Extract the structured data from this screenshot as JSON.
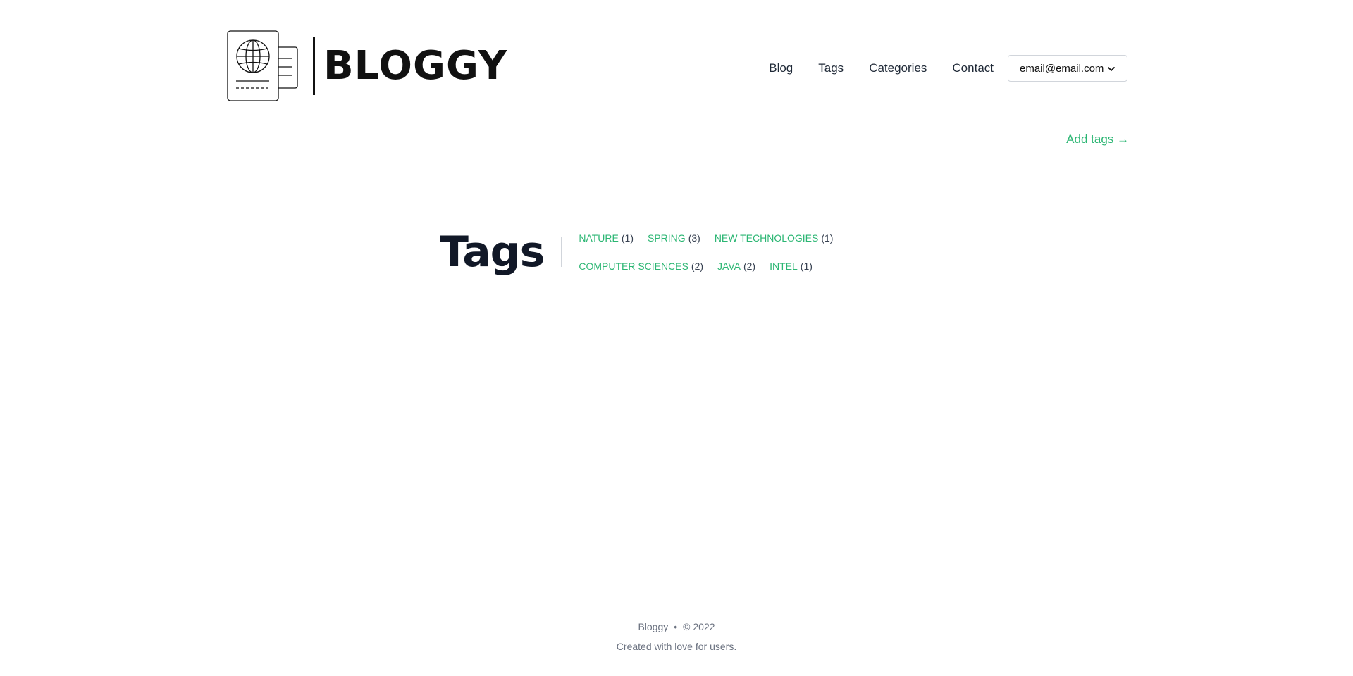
{
  "header": {
    "logo_text": "BLOGGY",
    "nav": [
      {
        "label": "Blog"
      },
      {
        "label": "Tags"
      },
      {
        "label": "Categories"
      },
      {
        "label": "Contact"
      }
    ],
    "user_email": "email@email.com"
  },
  "main": {
    "add_tags_label": "Add tags →",
    "heading": "Tags",
    "tags": [
      {
        "name": "NATURE",
        "count": "(1)"
      },
      {
        "name": "SPRING",
        "count": "(3)"
      },
      {
        "name": "NEW TECHNOLOGIES",
        "count": "(1)"
      },
      {
        "name": "COMPUTER SCIENCES",
        "count": "(2)"
      },
      {
        "name": "JAVA",
        "count": "(2)"
      },
      {
        "name": "INTEL",
        "count": "(1)"
      }
    ]
  },
  "footer": {
    "brand": "Bloggy",
    "separator": "•",
    "copyright": "© 2022",
    "tagline": "Created with love for users."
  },
  "colors": {
    "accent": "#2bb673",
    "text": "#111827",
    "muted": "#6b7280"
  },
  "icons": {
    "logo": "passport-globe-icon",
    "dropdown": "chevron-down-icon"
  }
}
